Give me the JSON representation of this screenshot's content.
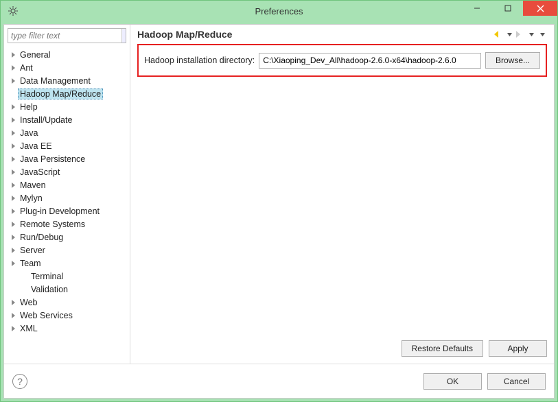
{
  "window": {
    "title": "Preferences"
  },
  "sidebar": {
    "filter_placeholder": "type filter text",
    "items": [
      {
        "label": "General",
        "expandable": true,
        "level": 0
      },
      {
        "label": "Ant",
        "expandable": true,
        "level": 0
      },
      {
        "label": "Data Management",
        "expandable": true,
        "level": 0
      },
      {
        "label": "Hadoop Map/Reduce",
        "expandable": false,
        "level": 0,
        "selected": true
      },
      {
        "label": "Help",
        "expandable": true,
        "level": 0
      },
      {
        "label": "Install/Update",
        "expandable": true,
        "level": 0
      },
      {
        "label": "Java",
        "expandable": true,
        "level": 0
      },
      {
        "label": "Java EE",
        "expandable": true,
        "level": 0
      },
      {
        "label": "Java Persistence",
        "expandable": true,
        "level": 0
      },
      {
        "label": "JavaScript",
        "expandable": true,
        "level": 0
      },
      {
        "label": "Maven",
        "expandable": true,
        "level": 0
      },
      {
        "label": "Mylyn",
        "expandable": true,
        "level": 0
      },
      {
        "label": "Plug-in Development",
        "expandable": true,
        "level": 0
      },
      {
        "label": "Remote Systems",
        "expandable": true,
        "level": 0
      },
      {
        "label": "Run/Debug",
        "expandable": true,
        "level": 0
      },
      {
        "label": "Server",
        "expandable": true,
        "level": 0
      },
      {
        "label": "Team",
        "expandable": true,
        "level": 0
      },
      {
        "label": "Terminal",
        "expandable": false,
        "level": 1
      },
      {
        "label": "Validation",
        "expandable": false,
        "level": 1
      },
      {
        "label": "Web",
        "expandable": true,
        "level": 0
      },
      {
        "label": "Web Services",
        "expandable": true,
        "level": 0
      },
      {
        "label": "XML",
        "expandable": true,
        "level": 0
      }
    ]
  },
  "main": {
    "title": "Hadoop Map/Reduce",
    "field_label": "Hadoop installation directory:",
    "field_value": "C:\\Xiaoping_Dev_All\\hadoop-2.6.0-x64\\hadoop-2.6.0",
    "browse_label": "Browse...",
    "restore_label": "Restore Defaults",
    "apply_label": "Apply"
  },
  "footer": {
    "ok_label": "OK",
    "cancel_label": "Cancel"
  }
}
